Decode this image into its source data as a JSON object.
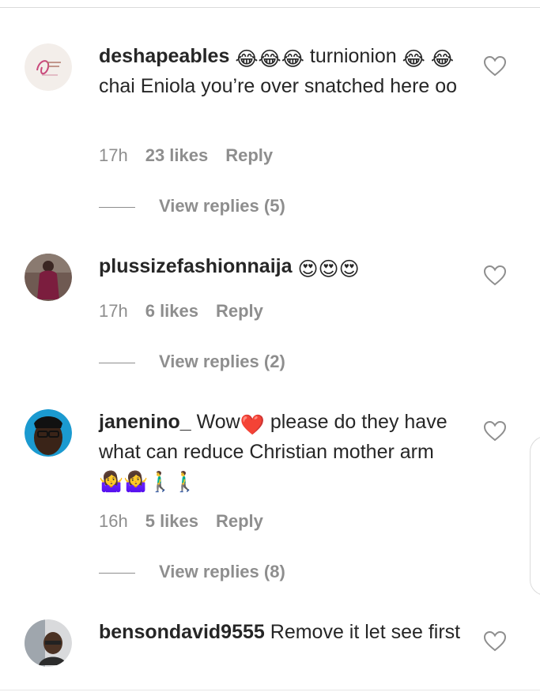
{
  "comments": [
    {
      "username": "deshapeables",
      "emoji_a": "😂😂😂",
      "text_a": " turnionion ",
      "emoji_b": "😂",
      "emoji_c": "😂",
      "text_b": " chai Eniola you’re over snatched here oo",
      "time": "17h",
      "likes": "23 likes",
      "reply": "Reply",
      "view_replies": "View replies (5)",
      "avatar_icon": "brand-logo-avatar"
    },
    {
      "username": "plussizefashionnaija",
      "emoji_a": "😍😍😍",
      "time": "17h",
      "likes": "6 likes",
      "reply": "Reply",
      "view_replies": "View replies (2)",
      "avatar_icon": "person-photo-avatar"
    },
    {
      "username": "janenino_",
      "text_a": " Wow",
      "emoji_a": "❤️",
      "text_b": " please do they have what can reduce Christian mother arm",
      "emoji_b": "🤷‍♀️🤷‍♀️🚶‍♂️🚶‍♂️",
      "time": "16h",
      "likes": "5 likes",
      "reply": "Reply",
      "view_replies": "View replies (8)",
      "avatar_icon": "person-photo-avatar"
    },
    {
      "username": "bensondavid9555",
      "text_a": " Remove it let see first",
      "avatar_icon": "person-photo-avatar"
    }
  ],
  "icons": {
    "like": "heart-outline-icon"
  },
  "colors": {
    "username": "#262626",
    "meta": "#8e8e8e",
    "heart_stroke": "#8e8e8e"
  }
}
